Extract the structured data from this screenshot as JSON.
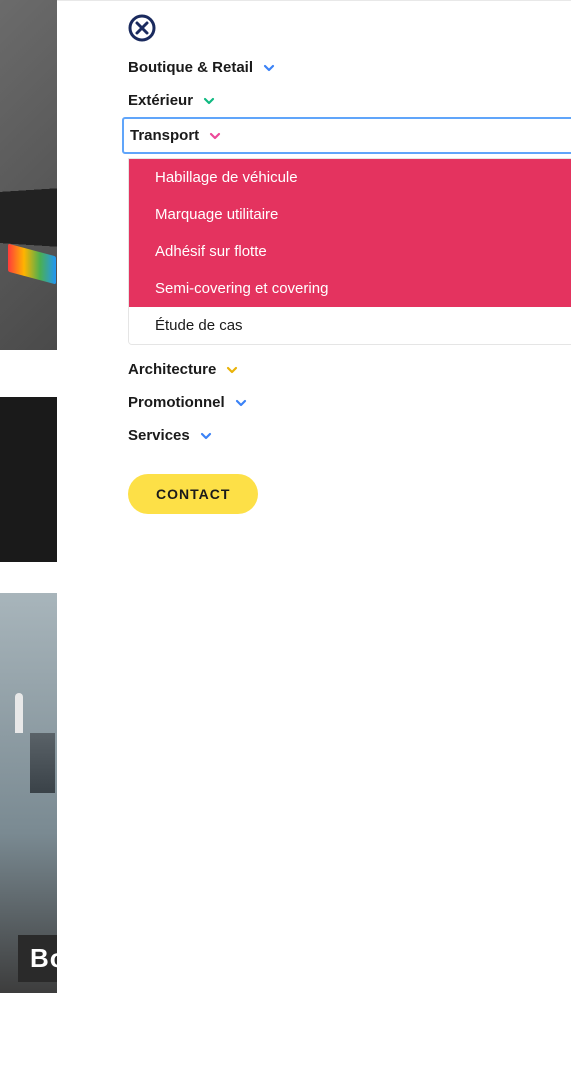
{
  "menu": {
    "items": [
      {
        "label": "Boutique & Retail",
        "chevron": "blue"
      },
      {
        "label": "Extérieur",
        "chevron": "green"
      },
      {
        "label": "Transport",
        "chevron": "pink",
        "open": true,
        "submenu": {
          "highlighted": [
            "Habillage de véhicule",
            "Marquage utilitaire",
            "Adhésif sur flotte",
            "Semi-covering et covering"
          ],
          "plain": [
            "Étude de cas"
          ]
        }
      },
      {
        "label": "Architecture",
        "chevron": "yellow"
      },
      {
        "label": "Promotionnel",
        "chevron": "blue"
      },
      {
        "label": "Services",
        "chevron": "blue"
      }
    ]
  },
  "contact_label": "CONTACT",
  "bg_label": "Bo"
}
